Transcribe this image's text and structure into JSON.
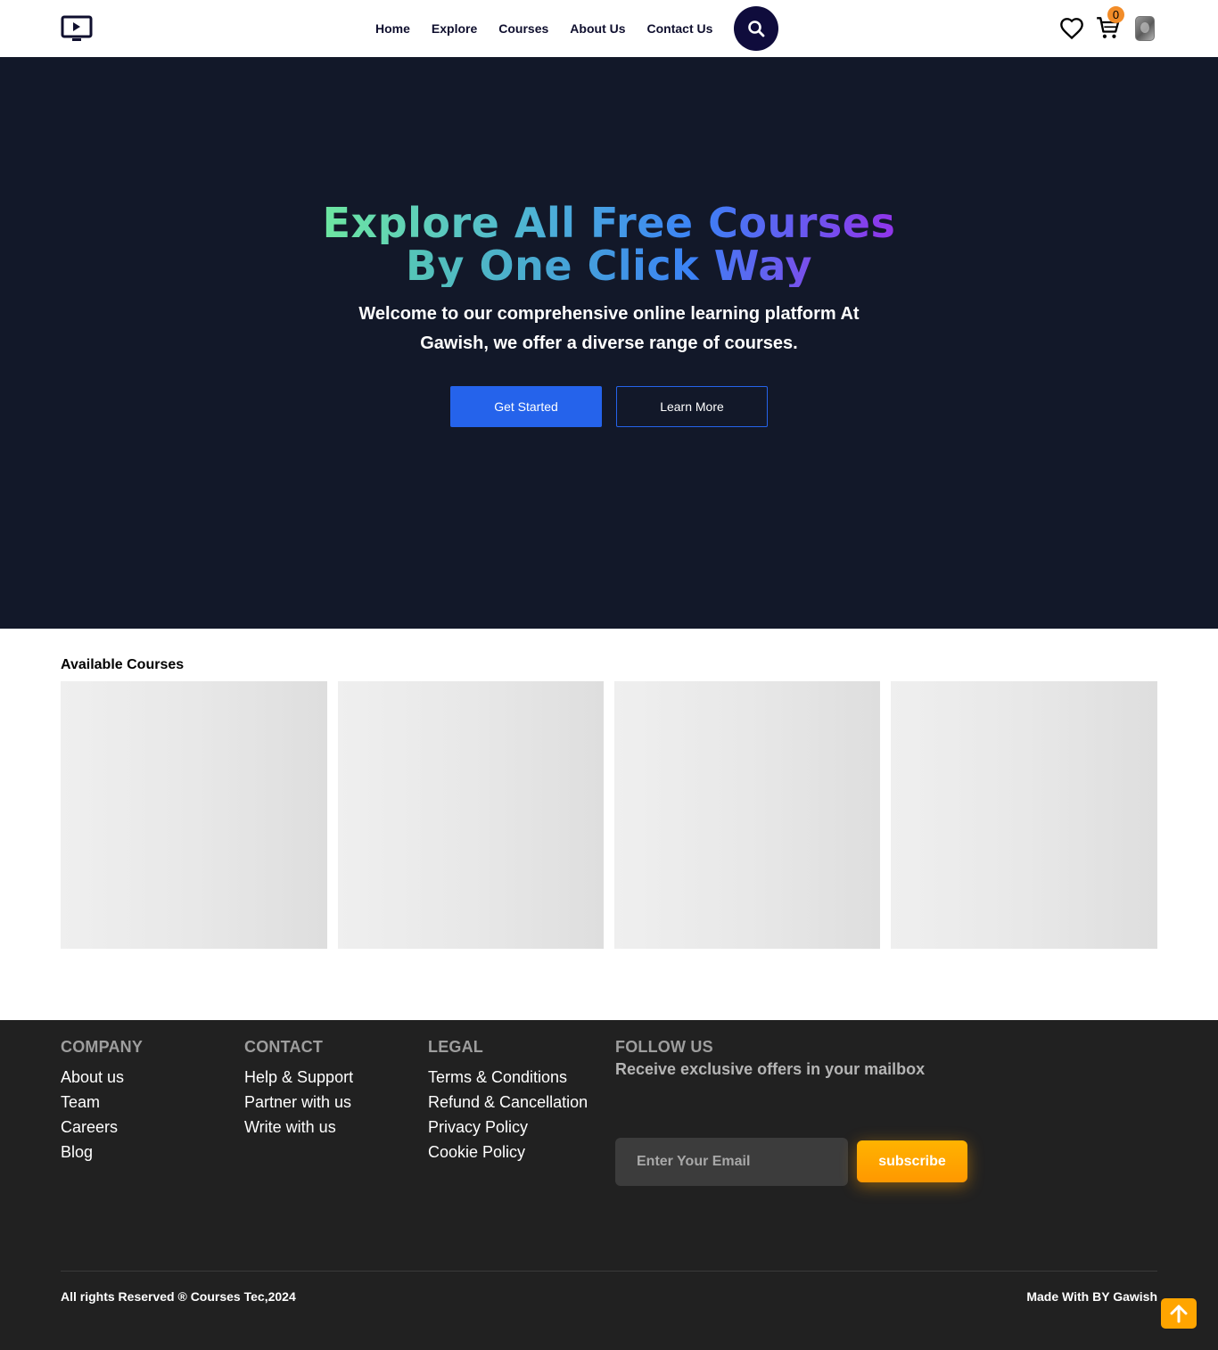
{
  "nav": {
    "logo_icon": "tv-play-icon",
    "links": [
      "Home",
      "Explore",
      "Courses",
      "About Us",
      "Contact Us"
    ],
    "search_icon": "search-icon",
    "wishlist_icon": "heart-icon",
    "cart_icon": "cart-icon",
    "cart_count": "0",
    "badge_color": "#f28c28"
  },
  "hero": {
    "title_line1": "Explore All Free Courses",
    "title_line2": "By One Click Way",
    "subtitle": "Welcome to our comprehensive online learning platform At Gawish, we offer a diverse range of courses.",
    "primary_button": "Get Started",
    "secondary_button": "Learn More",
    "background_color": "#121829",
    "accent_color": "#2563eb"
  },
  "courses": {
    "heading": "Available Courses",
    "card_count": 4
  },
  "footer": {
    "columns": [
      {
        "heading": "COMPANY",
        "links": [
          "About us",
          "Team",
          "Careers",
          "Blog"
        ]
      },
      {
        "heading": "CONTACT",
        "links": [
          "Help & Support",
          "Partner with us",
          "Write with us"
        ]
      },
      {
        "heading": "LEGAL",
        "links": [
          "Terms & Conditions",
          "Refund & Cancellation",
          "Privacy Policy",
          "Cookie Policy"
        ]
      }
    ],
    "follow": {
      "heading": "FOLLOW US",
      "subtitle": "Receive exclusive offers in your mailbox",
      "email_placeholder": "Enter Your Email",
      "subscribe_label": "subscribe"
    },
    "copyright": "All rights Reserved ® Courses Tec,2024",
    "made_by": "Made With BY Gawish",
    "background_color": "#212121",
    "subscribe_color": "#ffa500"
  },
  "scroll_top_icon": "arrow-up-icon"
}
